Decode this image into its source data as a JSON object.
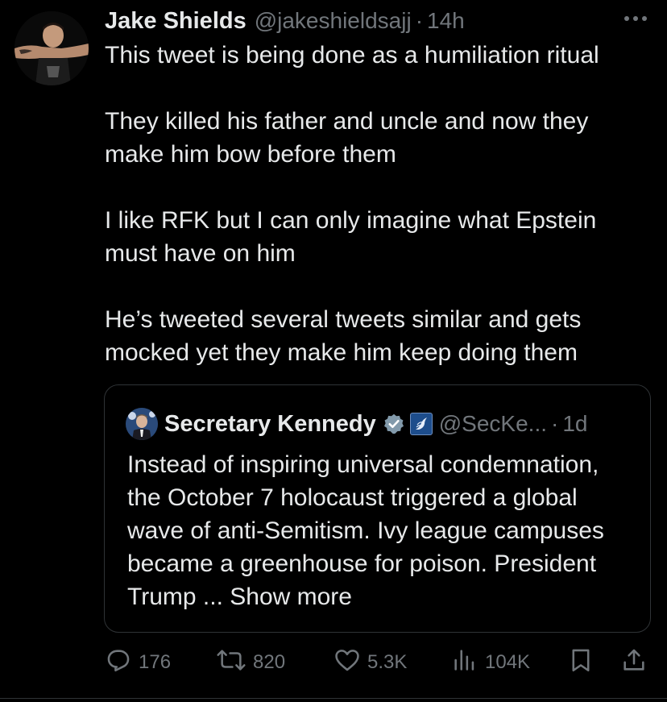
{
  "tweet": {
    "author_name": "Jake Shields",
    "author_handle": "@jakeshieldsajj",
    "separator": "·",
    "time": "14h",
    "paragraphs": [
      "This tweet is being done as a humiliation ritual",
      "They killed his father and uncle and now they make him bow before them",
      "I like RFK but I can only imagine what Epstein must have on him",
      "He’s tweeted several tweets similar and gets mocked yet they make him keep doing them"
    ]
  },
  "quote": {
    "author_name": "Secretary Kennedy",
    "author_handle": "@SecKe...",
    "separator": "·",
    "time": "1d",
    "text": "Instead of inspiring universal condemnation, the October 7 holocaust triggered a global wave of anti-Semitism. Ivy league campuses became a greenhouse for poison. President Trump ...",
    "show_more": "Show more"
  },
  "actions": {
    "replies": "176",
    "reposts": "820",
    "likes": "5.3K",
    "views": "104K"
  },
  "icons": {
    "more": "more-dots-icon",
    "verified": "verified-badge-icon",
    "gov": "government-affiliation-icon",
    "reply": "reply-icon",
    "repost": "repost-icon",
    "like": "heart-icon",
    "views": "views-icon",
    "bookmark": "bookmark-icon",
    "share": "share-icon"
  },
  "colors": {
    "background": "#000000",
    "text": "#e7e9ea",
    "muted": "#71767b",
    "border": "#2f3336",
    "verified_gray": "#829aab"
  }
}
